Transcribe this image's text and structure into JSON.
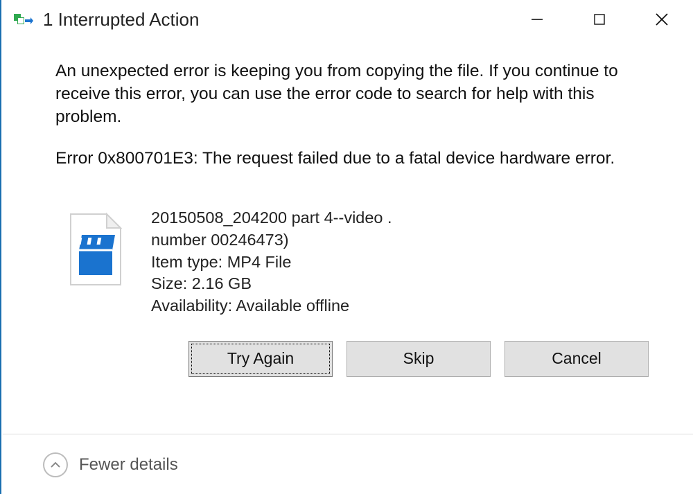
{
  "titlebar": {
    "title": "1 Interrupted Action"
  },
  "content": {
    "message": "An unexpected error is keeping you from copying the file. If you continue to receive this error, you can use the error code to search for help with this problem.",
    "error_line": "Error 0x800701E3: The request failed due to a fatal device hardware error."
  },
  "file": {
    "name_line1": "20150508_204200 part 4--video .",
    "name_line2": "number 00246473)",
    "type_label": "Item type: MP4 File",
    "size_label": "Size: 2.16 GB",
    "availability_label": "Availability: Available offline"
  },
  "buttons": {
    "try_again": "Try Again",
    "skip": "Skip",
    "cancel": "Cancel"
  },
  "details": {
    "toggle_label": "Fewer details"
  }
}
